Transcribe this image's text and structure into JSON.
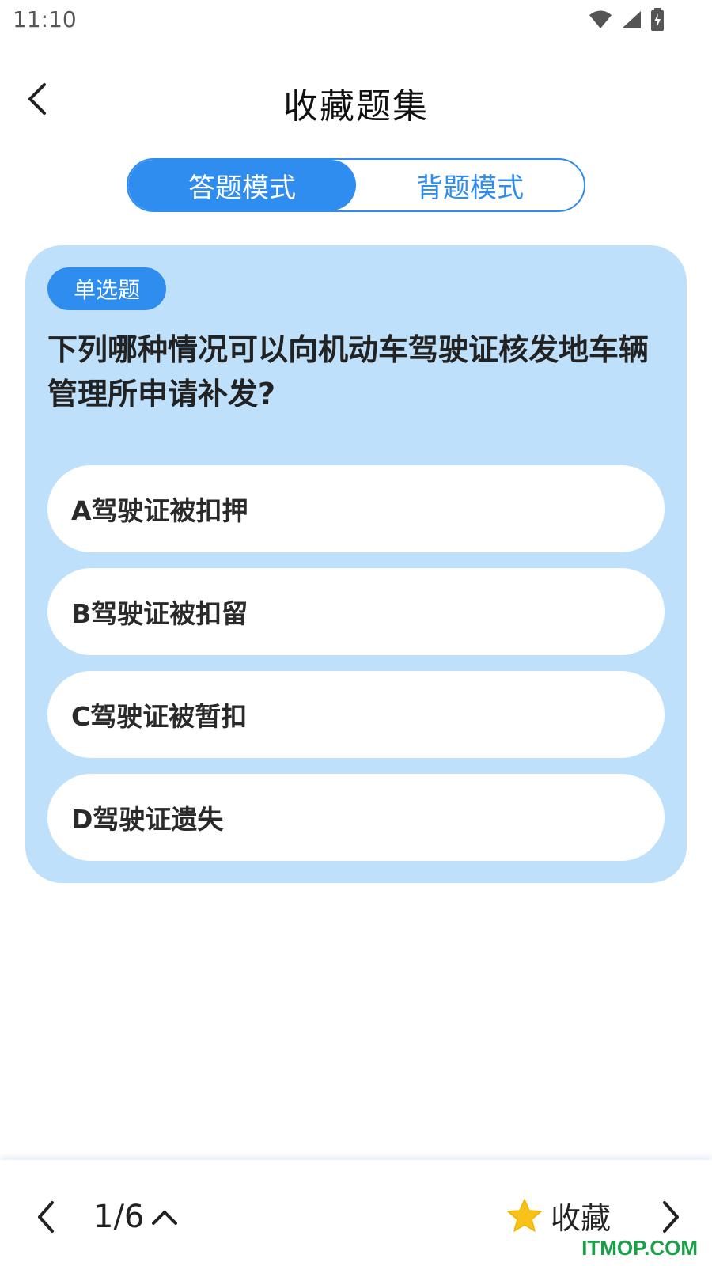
{
  "status": {
    "time": "11:10",
    "icons": [
      "wifi-icon",
      "signal-icon",
      "battery-charging-icon"
    ]
  },
  "header": {
    "title": "收藏题集",
    "back_icon": "chevron-left-icon"
  },
  "mode_toggle": {
    "answer_mode": "答题模式",
    "memorize_mode": "背题模式",
    "active": "answer_mode"
  },
  "question": {
    "type": "单选题",
    "text": "下列哪种情况可以向机动车驾驶证核发地车辆管理所申请补发?",
    "options": [
      "A驾驶证被扣押",
      "B驾驶证被扣留",
      "C驾驶证被暂扣",
      "D驾驶证遗失"
    ]
  },
  "footer": {
    "page": "1/6",
    "favorite_label": "收藏",
    "prev_icon": "chevron-left-icon",
    "expand_icon": "chevron-up-icon",
    "star_icon": "star-icon",
    "next_icon": "chevron-right-icon"
  },
  "watermark": "ITMOP.COM",
  "colors": {
    "accent": "#2f8df0",
    "card_bg": "#bfe0fb",
    "star": "#f7c21a",
    "watermark": "#1aa048"
  }
}
